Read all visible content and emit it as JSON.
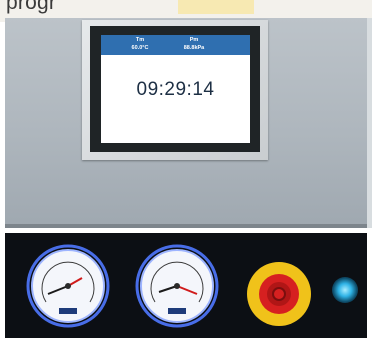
{
  "top_banner": {
    "text": "progr"
  },
  "hmi": {
    "temp": {
      "label": "Tm",
      "value": "60.0°C"
    },
    "pressure": {
      "label": "Pm",
      "value": "88.8kPa"
    },
    "clock": "09:29:14"
  },
  "colors": {
    "panel": "#aeb6bd",
    "hmi_header": "#2f6fb0",
    "gauge_ring_glow": "#5b8cff",
    "estop_red": "#d62020",
    "estop_yellow": "#f0c21a",
    "indicator": "#2fb3e6"
  },
  "icons": [
    "pressure-gauge-icon",
    "pressure-gauge-icon",
    "emergency-stop-icon",
    "power-indicator-icon"
  ]
}
